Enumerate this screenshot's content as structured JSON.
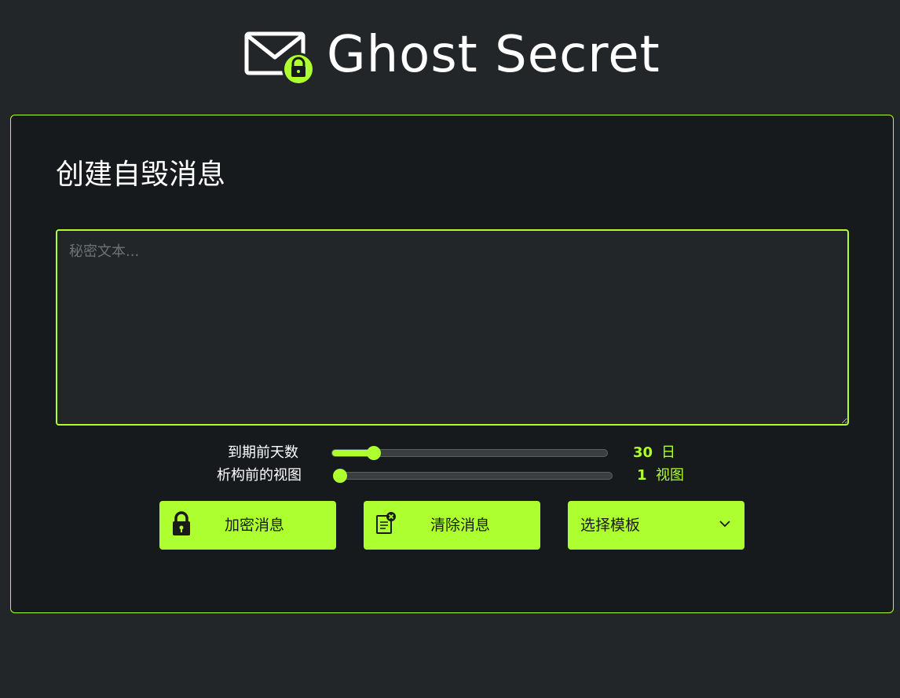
{
  "header": {
    "logo_text": "Ghost Secret",
    "logo_icon": "envelope-lock-icon",
    "accent_color": "#adff2f"
  },
  "form": {
    "title": "创建自毁消息",
    "secret_placeholder": "秘密文本...",
    "secret_value": ""
  },
  "sliders": {
    "expiry": {
      "label": "到期前天数",
      "value": "30",
      "unit": "日",
      "fraction": 0.15
    },
    "views": {
      "label": "析构前的视图",
      "value": "1",
      "unit": "视图",
      "fraction": 0.0
    }
  },
  "buttons": {
    "encrypt_label": "加密消息",
    "encrypt_icon": "lock-icon",
    "clear_label": "清除消息",
    "clear_icon": "clear-document-icon",
    "template_label": "选择模板",
    "template_icon": "chevron-down-icon"
  }
}
